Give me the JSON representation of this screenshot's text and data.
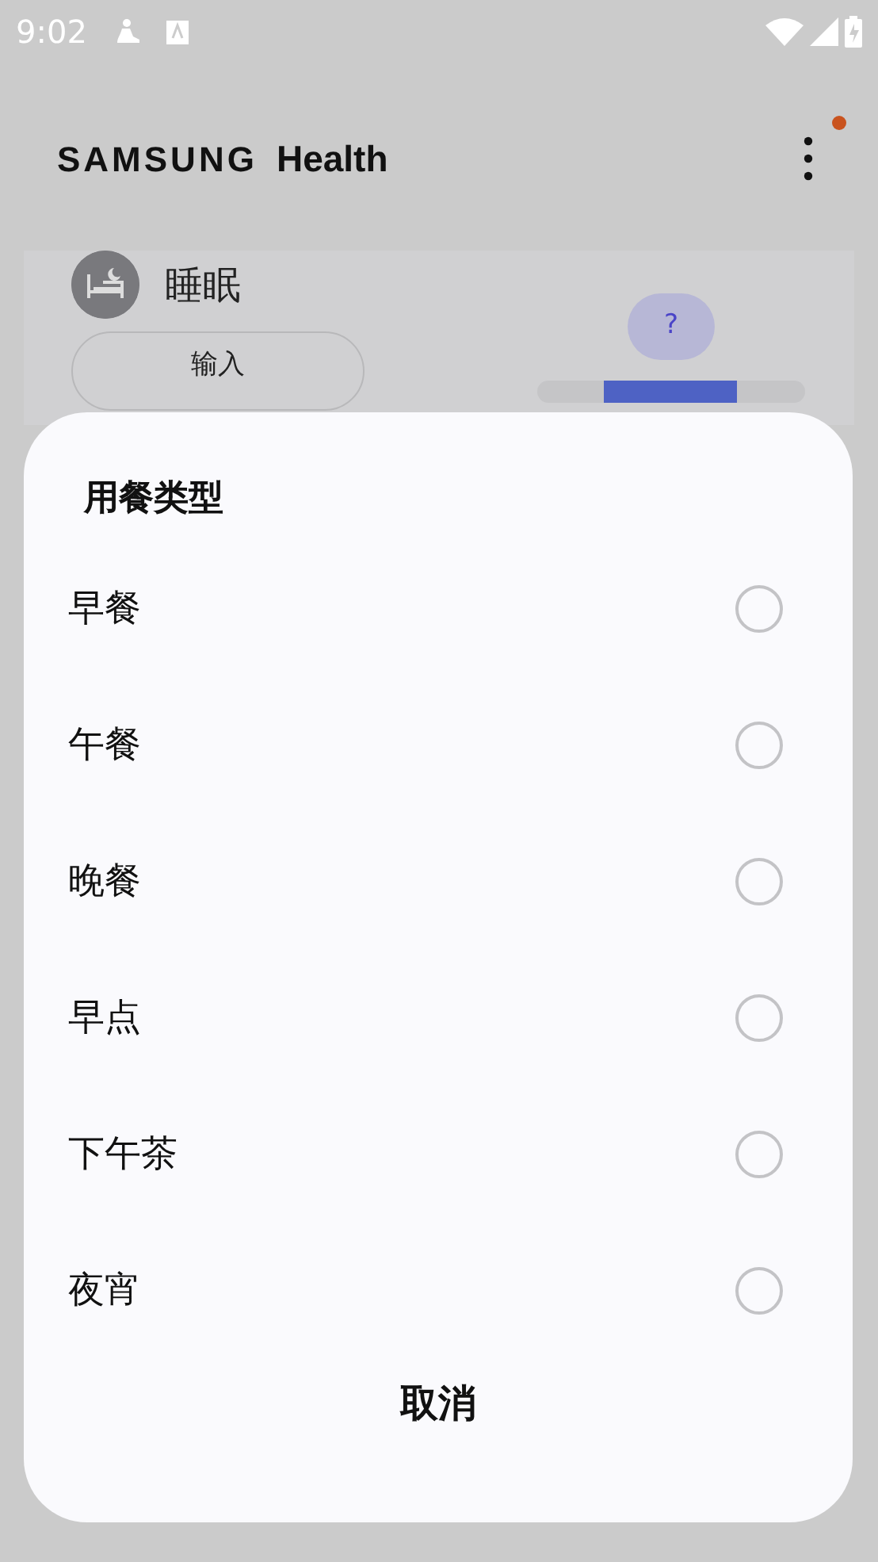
{
  "status_bar": {
    "time": "9:02"
  },
  "header": {
    "logo_brand": "SAMSUNG",
    "logo_product": "Health",
    "menu_badge": true
  },
  "card": {
    "title": "睡眠",
    "input_button": "输入",
    "tooltip": "?"
  },
  "dialog": {
    "title": "用餐类型",
    "options": [
      {
        "label": "早餐",
        "selected": false
      },
      {
        "label": "午餐",
        "selected": false
      },
      {
        "label": "晚餐",
        "selected": false
      },
      {
        "label": "早点",
        "selected": false
      },
      {
        "label": "下午茶",
        "selected": false
      },
      {
        "label": "夜宵",
        "selected": false
      }
    ],
    "cancel": "取消"
  }
}
